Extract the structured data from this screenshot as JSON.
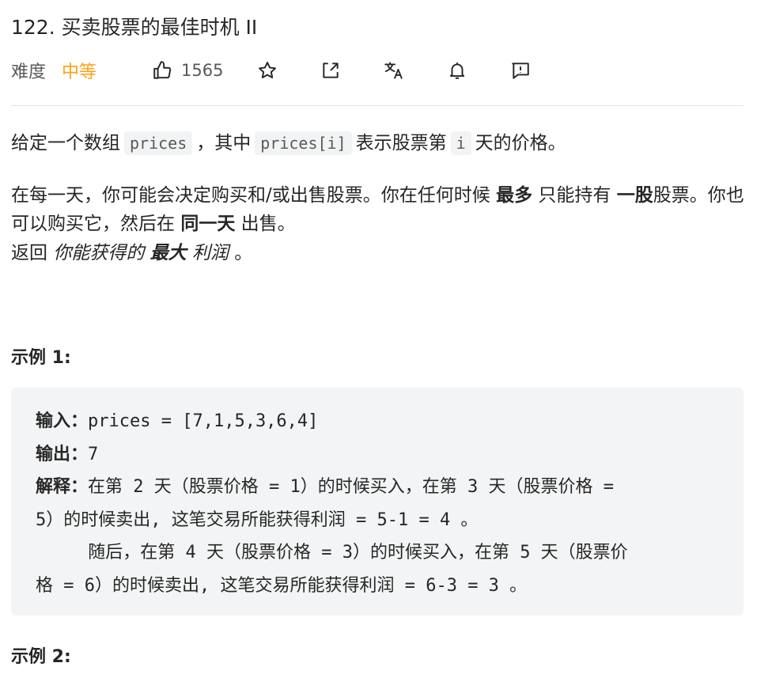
{
  "problem": {
    "title": "122. 买卖股票的最佳时机 II",
    "difficulty_label": "难度",
    "difficulty": "中等",
    "likes": "1565"
  },
  "icons": [
    "thumbs-up-icon",
    "star-icon",
    "share-icon",
    "translate-icon",
    "bell-icon",
    "feedback-icon"
  ],
  "colors": {
    "difficulty_medium": "#ffa116",
    "code_bg": "#f3f4f5"
  },
  "description": {
    "p1_a": "给定一个数组",
    "p1_code1": "prices",
    "p1_b": "，其中",
    "p1_code2": "prices[i]",
    "p1_c": "表示股票第",
    "p1_code3": "i",
    "p1_d": "天的价格。",
    "p2_a": "在每一天，你可能会决定购买和/或出售股票。你在任何时候",
    "p2_b1": "最多",
    "p2_b": "只能持有",
    "p2_b2": "一股",
    "p2_c": "股票。你也可以购买它，然后在",
    "p2_b3": "同一天",
    "p2_d": "出售。",
    "p3_a": "返回",
    "p3_i1": "你能获得的",
    "p3_bi": "最大",
    "p3_i2": "利润",
    "p3_b": "。"
  },
  "example1": {
    "heading": "示例 1:",
    "input_label": "输入：",
    "input": "prices = [7,1,5,3,6,4]",
    "output_label": "输出：",
    "output": "7",
    "explain_label": "解释：",
    "explain_1": "在第 2 天（股票价格 = 1）的时候买入，在第 3 天（股票价格 =",
    "explain_2": "5）的时候卖出, 这笔交易所能获得利润 = 5-1 = 4 。",
    "explain_3": "     随后，在第 4 天（股票价格 = 3）的时候买入，在第 5 天（股票价",
    "explain_4": "格 = 6）的时候卖出, 这笔交易所能获得利润 = 6-3 = 3 。"
  },
  "example2": {
    "heading": "示例 2:"
  }
}
